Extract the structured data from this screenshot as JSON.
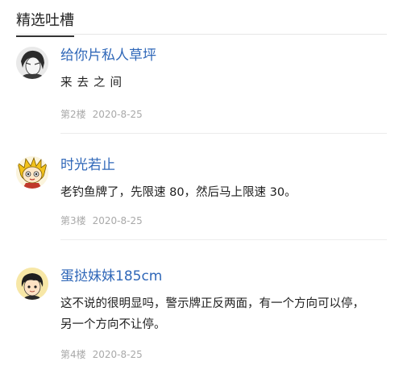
{
  "section": {
    "title": "精选吐槽"
  },
  "comments": [
    {
      "username": "给你片私人草坪",
      "avatar_icon": "sketch-portrait-avatar",
      "lines": [
        "来去之间"
      ],
      "floor": "第2楼",
      "date": "2020-8-25"
    },
    {
      "username": "时光若止",
      "avatar_icon": "cartoon-character-avatar",
      "lines": [
        "老钓鱼牌了，先限速 80，然后马上限速 30。"
      ],
      "floor": "第3楼",
      "date": "2020-8-25"
    },
    {
      "username": "蛋挞妹妹185cm",
      "avatar_icon": "cartoon-girl-avatar",
      "lines": [
        "这不说的很明显吗，警示牌正反两面，有一个方向可以停，",
        "另一个方向不让停。"
      ],
      "floor": "第4楼",
      "date": "2020-8-25"
    }
  ],
  "colors": {
    "username": "#2f67b8",
    "meta": "#a9a9a9",
    "text": "#1e1e1e"
  }
}
